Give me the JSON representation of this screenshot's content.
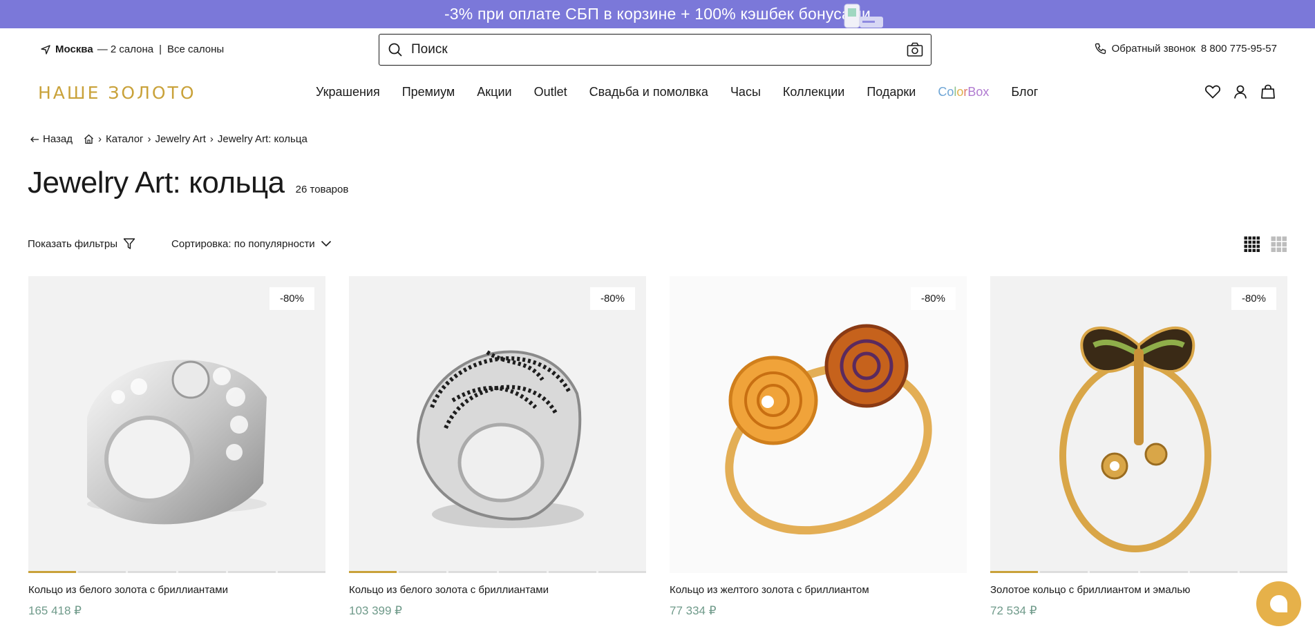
{
  "promo": {
    "text": "-3% при оплате СБП в корзине + 100% кэшбек бонусами",
    "art_icon": "phone-card-icon"
  },
  "topbar": {
    "city": "Москва",
    "salons_text": "— 2 салона",
    "all_salons": "Все салоны",
    "search_placeholder": "Поиск",
    "callback": "Обратный звонок",
    "phone": "8 800 775-95-57"
  },
  "nav": {
    "logo": "НАШЕ ЗОЛОТО",
    "items": [
      "Украшения",
      "Премиум",
      "Акции",
      "Outlet",
      "Свадьба и помолвка",
      "Часы",
      "Коллекции",
      "Подарки",
      "ColorBox",
      "Блог"
    ],
    "icons": [
      "heart-icon",
      "user-icon",
      "bag-icon"
    ]
  },
  "breadcrumbs": {
    "back": "Назад",
    "items": [
      "Каталог",
      "Jewelry Art",
      "Jewelry Art: кольца"
    ]
  },
  "page": {
    "title": "Jewelry Art: кольца",
    "count": "26 товаров"
  },
  "filters": {
    "show_filters": "Показать фильтры",
    "sort": "Сортировка: по популярности"
  },
  "products": [
    {
      "name": "Кольцо из белого золота с бриллиантами",
      "price": "165 418 ₽",
      "badge": "-80%"
    },
    {
      "name": "Кольцо из белого золота с бриллиантами",
      "price": "103 399 ₽",
      "badge": "-80%"
    },
    {
      "name": "Кольцо из желтого золота с бриллиантом",
      "price": "77 334 ₽",
      "badge": "-80%"
    },
    {
      "name": "Золотое кольцо с бриллиантом и эмалью",
      "price": "72 534 ₽",
      "badge": "-80%"
    }
  ],
  "colors": {
    "promo_bg": "#7b78d9",
    "gold": "#c9a23a",
    "price": "#6f9a8a"
  }
}
